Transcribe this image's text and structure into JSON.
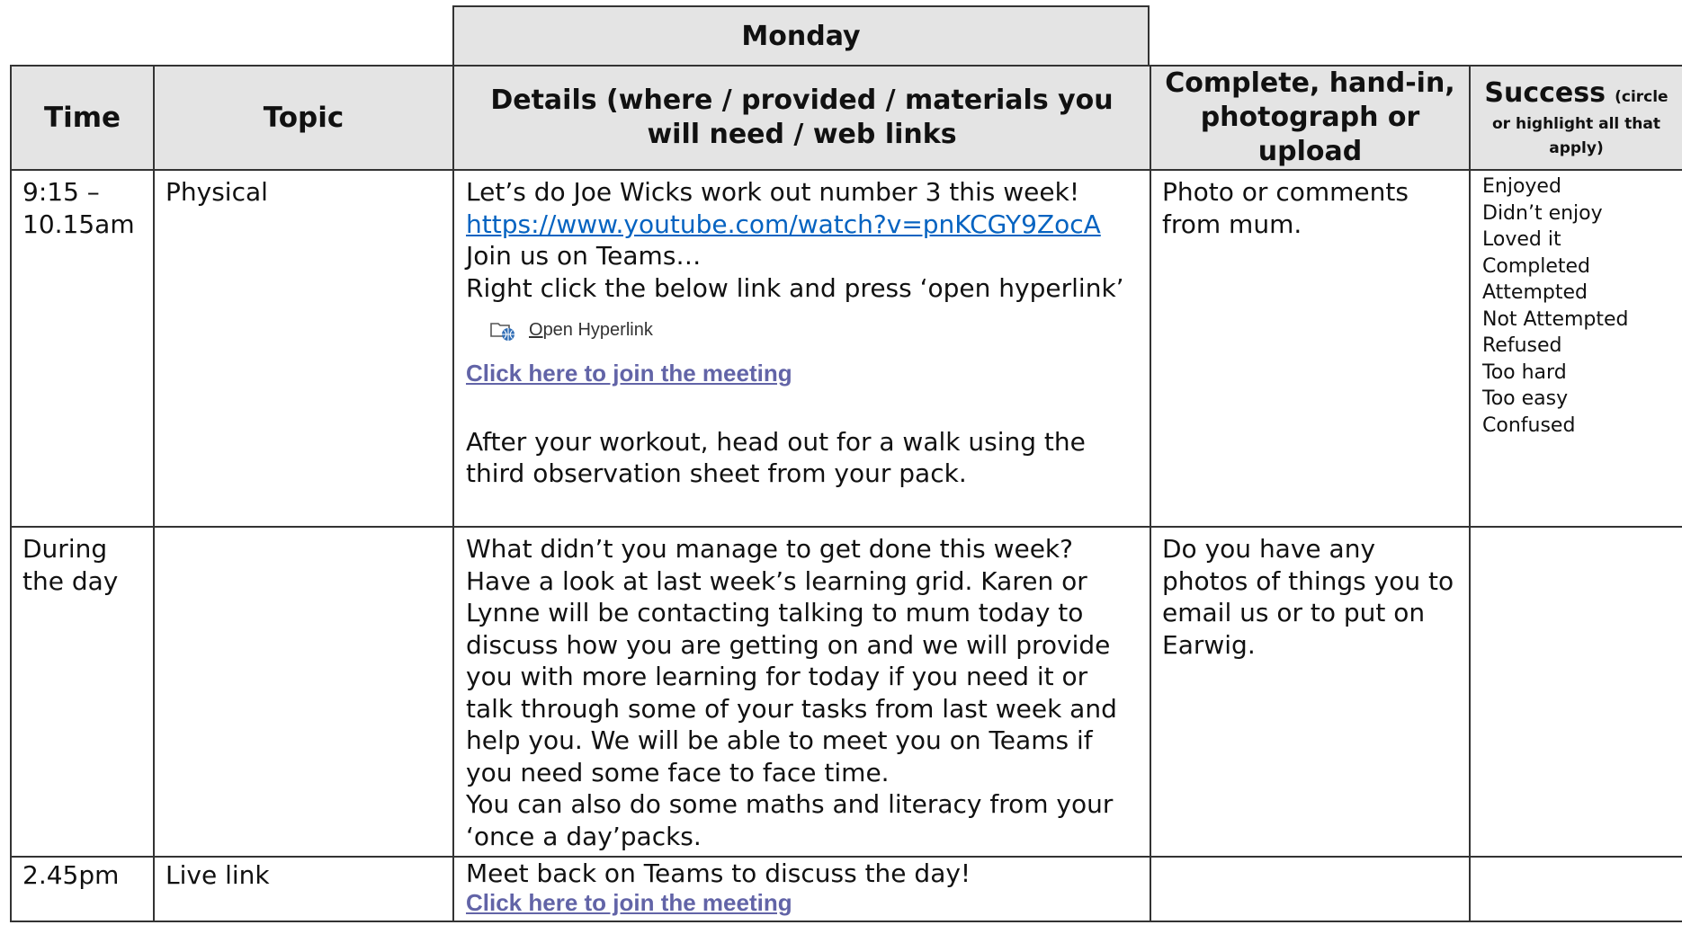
{
  "header": {
    "day": "Monday"
  },
  "columns": {
    "time": "Time",
    "topic": "Topic",
    "details": "Details (where / provided / materials you will need / web links",
    "complete": "Complete, hand-in, photograph or upload",
    "success_main": "Success",
    "success_sub": "(circle or highlight all that apply)"
  },
  "rows": [
    {
      "time": "9:15 – 10.15am",
      "topic": "Physical",
      "details": {
        "line1": "Let’s do Joe Wicks work out number 3 this week!",
        "youtube_link": "https://www.youtube.com/watch?v=pnKCGY9ZocA",
        "line2": "Join us on Teams…",
        "line3": "Right click the below link and press ‘open hyperlink’",
        "open_hyperlink_first": "O",
        "open_hyperlink_rest": "pen Hyperlink",
        "meeting_link": "Click here to join the meeting",
        "line4": "After your workout, head out for a walk using the third observation sheet from your pack."
      },
      "complete": "Photo or comments from mum.",
      "success": [
        "Enjoyed",
        "Didn’t enjoy",
        "Loved it",
        "Completed",
        "Attempted",
        "Not Attempted",
        "Refused",
        "Too hard",
        "Too easy",
        "Confused"
      ]
    },
    {
      "time": "During the day",
      "topic": "",
      "details": {
        "para1": "What didn’t you manage to get done this week? Have a look at last week’s learning grid. Karen or Lynne will be contacting talking to mum today to discuss how you are getting on and we will provide you with more learning for today if you need it or talk through some of your tasks from last week and help you. We will be able to meet you on Teams if you need some face to face time.",
        "para2": "You can also do some maths and literacy from your ‘once a day’packs."
      },
      "complete": "Do you have any photos of things you to email us or to put on Earwig.",
      "success": []
    },
    {
      "time": "2.45pm",
      "topic": "Live link",
      "details": {
        "line1": "Meet back on Teams to discuss the day!",
        "meeting_link": "Click here to join the meeting"
      },
      "complete": "",
      "success": []
    }
  ]
}
